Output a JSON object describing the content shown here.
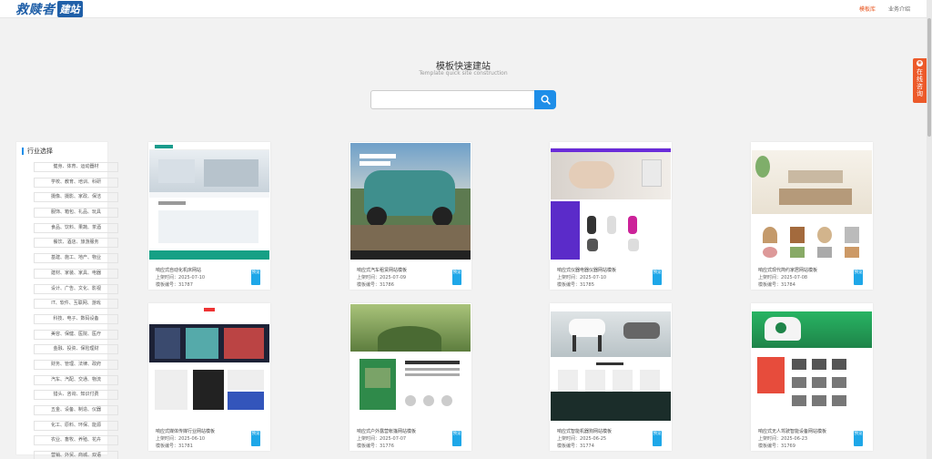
{
  "header": {
    "logo_text": "救赎者",
    "logo_badge": "建站",
    "nav": [
      {
        "label": "模板库",
        "active": true
      },
      {
        "label": "业务介绍",
        "active": false
      }
    ]
  },
  "consult": {
    "label": "在线咨询",
    "icon": "chat-icon"
  },
  "hero": {
    "title": "模板快速建站",
    "subtitle": "Template quick site construction",
    "search_placeholder": "",
    "search_icon": "search-icon"
  },
  "sidebar": {
    "title": "行业选择",
    "items": [
      "健身、体育、运动器材",
      "学校、教育、培训、科研",
      "摄像、摄影、家政、保洁",
      "服饰、箱包、礼品、玩具",
      "食品、饮料、果蔬、茶酒",
      "餐饮、酒店、旅游服务",
      "基建、施工、地产、物业",
      "建材、家装、家具、电器",
      "设计、广告、文化、影视",
      "IT、软件、互联网、游戏",
      "科技、电子、数码设备",
      "美容、保健、医院、医疗",
      "金融、投资、保险理财",
      "财务、管理、法律、政府",
      "汽车、汽配、交通、物流",
      "猎头、咨询、知识付费",
      "五金、设备、制造、仪器",
      "化工、原料、环保、能源",
      "农业、畜牧、养殖、花卉",
      "营销、外贸、商城、双语"
    ]
  },
  "colors": {
    "accent": "#1e8ee8",
    "brand": "#1f5fa8",
    "consult": "#ec5a2a",
    "nav_active": "#e8551f"
  },
  "templates": [
    {
      "name": "响应式自动化机床网站",
      "date_label": "上架时间：",
      "date": "2025-07-10",
      "id_label": "模板编号：",
      "id": "31787",
      "btn": "预览"
    },
    {
      "name": "响应式汽车租赁网站模板",
      "date_label": "上架时间：",
      "date": "2025-07-09",
      "id_label": "模板编号：",
      "id": "31786",
      "btn": "预览"
    },
    {
      "name": "响应式仪器电器仪器网站模板",
      "date_label": "上架时间：",
      "date": "2025-07-10",
      "id_label": "模板编号：",
      "id": "31785",
      "btn": "预览"
    },
    {
      "name": "响应式现代简约家居网站模板",
      "date_label": "上架时间：",
      "date": "2025-07-08",
      "id_label": "模板编号：",
      "id": "31784",
      "btn": "预览"
    },
    {
      "name": "响应式媒体传媒行业网站模板",
      "date_label": "上架时间：",
      "date": "2025-06-10",
      "id_label": "模板编号：",
      "id": "31781",
      "btn": "预览"
    },
    {
      "name": "响应式户外露营帐篷网站模板",
      "date_label": "上架时间：",
      "date": "2025-07-07",
      "id_label": "模板编号：",
      "id": "31776",
      "btn": "预览"
    },
    {
      "name": "响应式智能机器狗网站模板",
      "date_label": "上架时间：",
      "date": "2025-06-25",
      "id_label": "模板编号：",
      "id": "31774",
      "btn": "预览"
    },
    {
      "name": "响应式无人驾驶智能设备网站模板",
      "date_label": "上架时间：",
      "date": "2025-06-23",
      "id_label": "模板编号：",
      "id": "31769",
      "btn": "预览"
    }
  ]
}
